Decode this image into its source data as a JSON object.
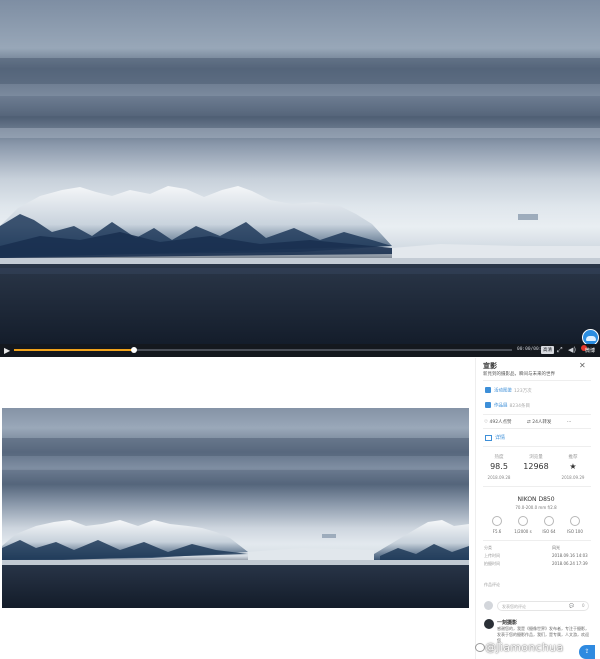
{
  "player": {
    "time": "00:00/00:24",
    "quality": "高清",
    "brand": "微博"
  },
  "panel": {
    "title": "宣影",
    "subtitle": "新見到的摄影品，瞬间与未来的世界",
    "row1": {
      "label": "活动图鉴",
      "count": "123万次"
    },
    "row2": {
      "label": "作品展",
      "count": "8234条目"
    },
    "actions": [
      "492人点赞",
      "24人转发"
    ],
    "tab": "详情",
    "stats": [
      {
        "label": "热度",
        "value": "98.5",
        "date": "2018.09.28"
      },
      {
        "label": "浏览量",
        "value": "12968",
        "date": ""
      },
      {
        "label": "推荐",
        "value": "★",
        "date": "2018.09.29"
      }
    ],
    "camera": "NIKON D850",
    "lens": "70.0-200.0 mm f/2.8",
    "exif": [
      "F5.6",
      "1/2000 s",
      "ISO 64",
      "ISO 100"
    ],
    "meta": [
      {
        "label": "分类",
        "value": "风光"
      },
      {
        "label": "上传时间",
        "value": "2018.09.16 14:03"
      },
      {
        "label": "拍摄时间",
        "value": "2018.06.24 17:39"
      }
    ],
    "section_label": "作品评论",
    "comment_placeholder": "发表您的评论",
    "comment_count": "0",
    "comment": {
      "name": "一刻摄影",
      "text": "感谢您的，我是《摄像世界》发布者，专注于摄影，发表于您的摄影作品，我们，是专属，人文游，欢迎您"
    }
  },
  "watermark": "@Jiamonchua",
  "colors": {
    "accent": "#3d8fd8",
    "progress": "#f0a21a"
  },
  "progress_fraction": 0.24
}
